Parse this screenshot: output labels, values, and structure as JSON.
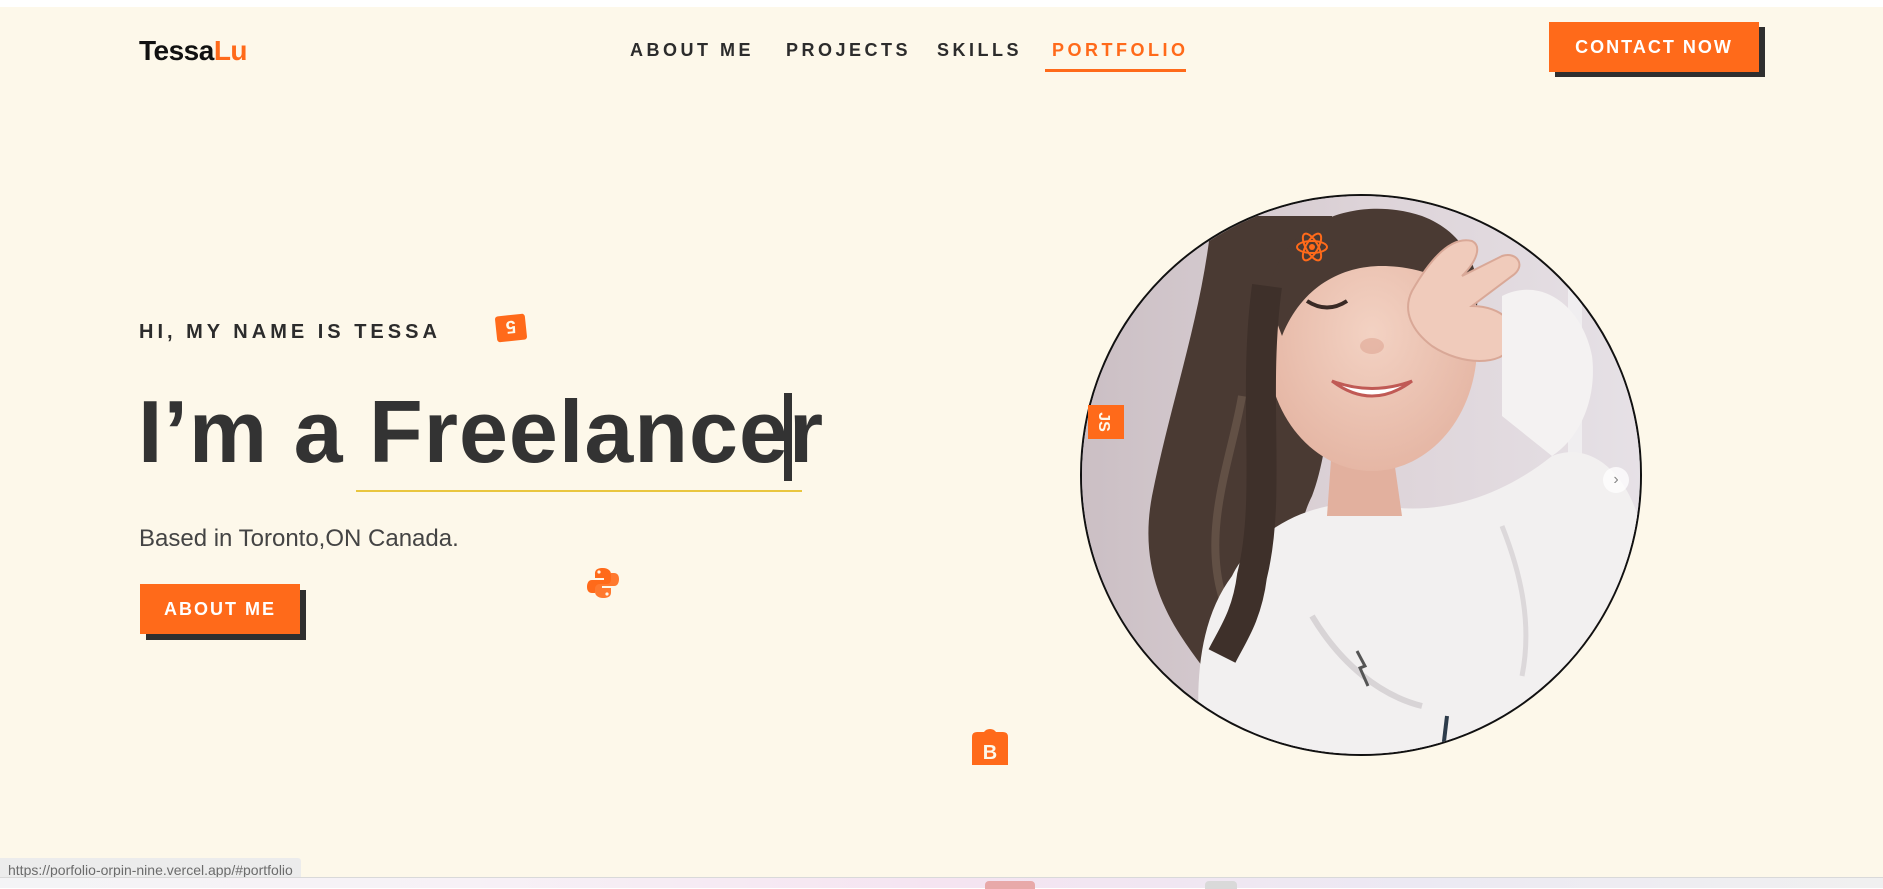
{
  "header": {
    "logo_part1": "Tessa",
    "logo_part2": "Lu",
    "nav": [
      {
        "label": "ABOUT ME",
        "active": false
      },
      {
        "label": "PROJECTS",
        "active": false
      },
      {
        "label": "SKILLS",
        "active": false
      },
      {
        "label": "PORTFOLIO",
        "active": true
      }
    ],
    "cta_label": "CONTACT NOW"
  },
  "hero": {
    "kicker": "HI, MY NAME IS TESSA",
    "headline_prefix": "I’m a ",
    "headline_typed": "Freelancer",
    "subtitle": "Based in Toronto,ON Canada.",
    "button_label": "ABOUT ME"
  },
  "floating_icons": [
    "html5-icon",
    "python-icon",
    "bootstrap-icon",
    "javascript-icon",
    "react-icon"
  ],
  "floating_icon_text": {
    "javascript": "JS",
    "bootstrap": "B",
    "html5": "5"
  },
  "status_bar": {
    "url": "https://porfolio-orpin-nine.vercel.app/#portfolio"
  },
  "colors": {
    "accent": "#ff6a1a",
    "background": "#fdf8ea",
    "text": "#2c2c2c",
    "underline": "#e9c63f"
  }
}
